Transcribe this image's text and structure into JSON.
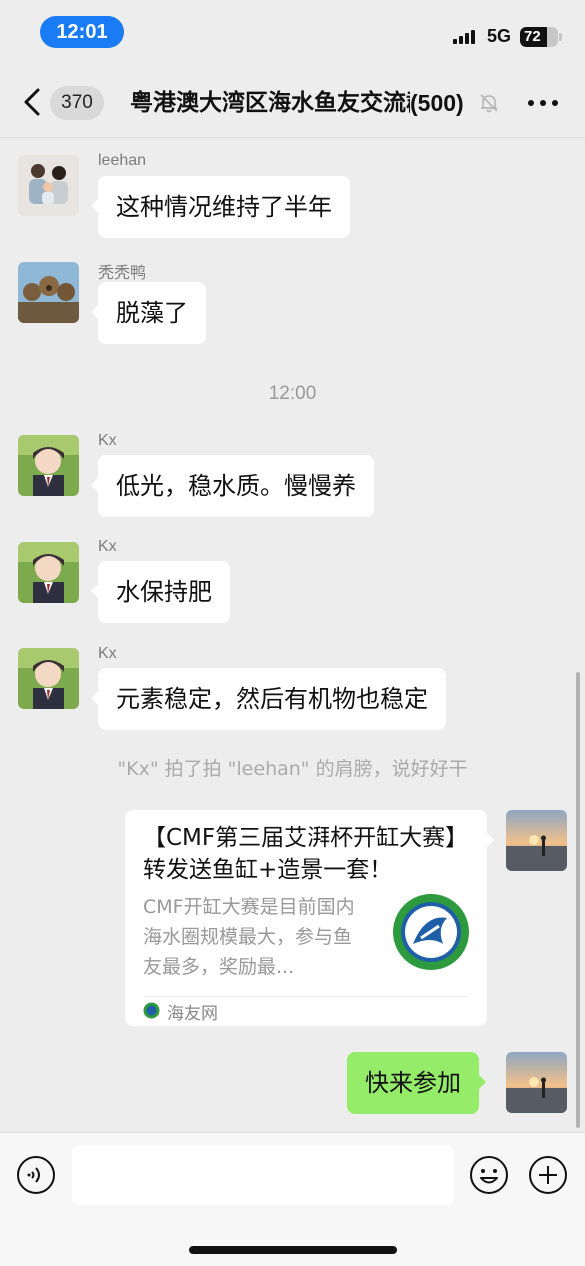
{
  "status_bar": {
    "time": "12:01",
    "network": "5G",
    "battery": "72",
    "battery_level": 0.72
  },
  "nav": {
    "unread_count": "370",
    "title": "粤港澳大湾区海水鱼友交流群",
    "member_count": "(500)"
  },
  "messages": [
    {
      "sender": "leehan",
      "text": "这种情况维持了半年",
      "avatar_icon": "family-photo"
    },
    {
      "sender": "秃秃鸭",
      "text": "脱藻了",
      "avatar_icon": "otters-photo"
    },
    {
      "timestamp": "12:00"
    },
    {
      "sender": "Kx",
      "text": "低光，稳水质。慢慢养",
      "avatar_icon": "anime-boy"
    },
    {
      "sender": "Kx",
      "text": "水保持肥",
      "avatar_icon": "anime-boy"
    },
    {
      "sender": "Kx",
      "text": "元素稳定，然后有机物也稳定",
      "avatar_icon": "anime-boy"
    },
    {
      "system": "\"Kx\" 拍了拍 \"leehan\" 的肩膀，说好好干"
    }
  ],
  "link_card": {
    "title": "【CMF第三届艾湃杯开缸大赛】转发送鱼缸+造景一套！",
    "description": "CMF开缸大赛是目前国内海水圈规模最大，参与鱼友最多，奖励最...",
    "source": "海友网",
    "avatar_icon": "sunset-beach"
  },
  "my_message": {
    "text": "快来参加",
    "avatar_icon": "sunset-beach"
  },
  "input": {
    "placeholder": ""
  },
  "colors": {
    "accent_blue": "#1a7cf5",
    "my_bubble": "#95ec69",
    "background": "#ededed"
  }
}
